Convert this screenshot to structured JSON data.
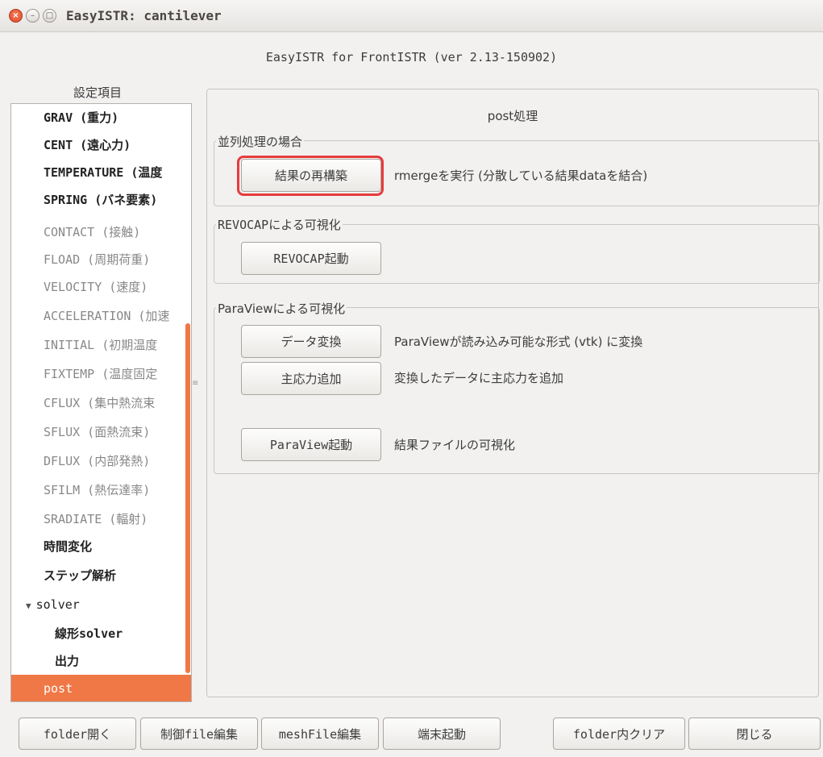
{
  "window": {
    "title": "EasyISTR: cantilever"
  },
  "app_header": "EasyISTR for FrontISTR  (ver 2.13-150902)",
  "tree": {
    "title": "設定項目",
    "items": [
      {
        "label": "GRAV (重力)",
        "style": "bold"
      },
      {
        "label": "CENT (遠心力)",
        "style": "bold"
      },
      {
        "label": "TEMPERATURE (温度",
        "style": "bold"
      },
      {
        "label": "SPRING (バネ要素)",
        "style": "bold"
      },
      {
        "label": "CONTACT (接触)",
        "style": "gray"
      },
      {
        "label": "FLOAD (周期荷重)",
        "style": "gray"
      },
      {
        "label": "VELOCITY (速度)",
        "style": "gray"
      },
      {
        "label": "ACCELERATION (加速",
        "style": "gray"
      },
      {
        "label": "INITIAL (初期温度",
        "style": "gray"
      },
      {
        "label": "FIXTEMP (温度固定",
        "style": "gray"
      },
      {
        "label": "CFLUX (集中熱流束",
        "style": "gray"
      },
      {
        "label": "SFLUX (面熱流束)",
        "style": "gray"
      },
      {
        "label": "DFLUX (内部発熱)",
        "style": "gray"
      },
      {
        "label": "SFILM (熱伝達率)",
        "style": "gray"
      },
      {
        "label": "SRADIATE (輻射)",
        "style": "gray"
      },
      {
        "label": "時間変化",
        "style": "top"
      },
      {
        "label": "ステップ解析",
        "style": "top"
      },
      {
        "label": "solver",
        "style": "top-expand"
      },
      {
        "label": "線形solver",
        "style": "bold"
      },
      {
        "label": "出力",
        "style": "bold"
      },
      {
        "label": "post",
        "style": "selected"
      }
    ]
  },
  "panel": {
    "title": "post処理",
    "parallel": {
      "label": "並列処理の場合",
      "rebuild_button": "結果の再構築",
      "rebuild_desc": "rmergeを実行 (分散している結果dataを結合)"
    },
    "revocap": {
      "label": "REVOCAPによる可視化",
      "start_button": "REVOCAP起動"
    },
    "paraview": {
      "label": "ParaViewによる可視化",
      "convert_button": "データ変換",
      "convert_desc": "ParaViewが読み込み可能な形式 (vtk) に変換",
      "principal_button": "主応力追加",
      "principal_desc": "変換したデータに主応力を追加",
      "start_button": "ParaView起動",
      "start_desc": "結果ファイルの可視化"
    }
  },
  "bottom": {
    "open_folder": "folder開く",
    "edit_control": "制御file編集",
    "edit_mesh": "meshFile編集",
    "terminal": "端末起動",
    "clear_folder": "folder内クリア",
    "close": "閉じる"
  },
  "colors": {
    "accent": "#f07746",
    "highlight": "#e63c3c"
  }
}
